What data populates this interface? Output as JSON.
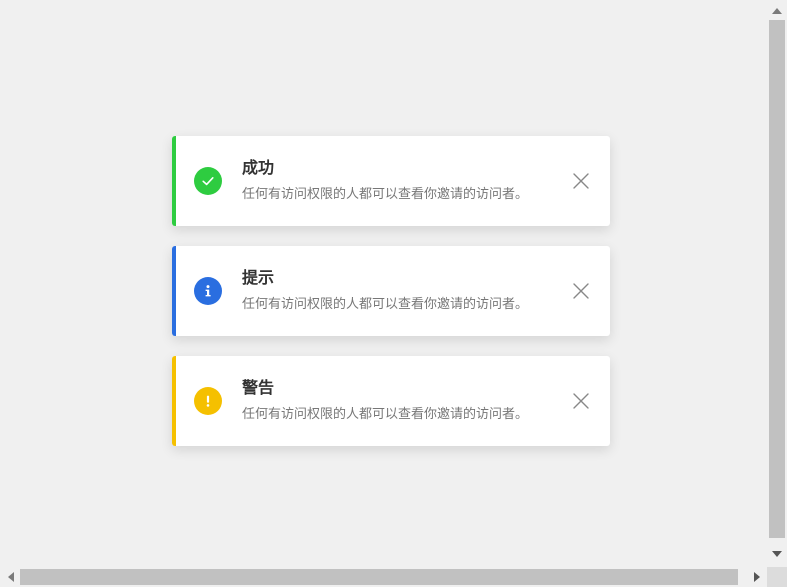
{
  "alerts": [
    {
      "type": "success",
      "title": "成功",
      "message": "任何有访问权限的人都可以查看你邀请的访问者。",
      "color": "#2ecc40",
      "icon": "check-circle-icon"
    },
    {
      "type": "info",
      "title": "提示",
      "message": "任何有访问权限的人都可以查看你邀请的访问者。",
      "color": "#2a6ee0",
      "icon": "info-circle-icon"
    },
    {
      "type": "warning",
      "title": "警告",
      "message": "任何有访问权限的人都可以查看你邀请的访问者。",
      "color": "#f5c000",
      "icon": "exclamation-circle-icon"
    }
  ],
  "close_icon": "close-icon"
}
